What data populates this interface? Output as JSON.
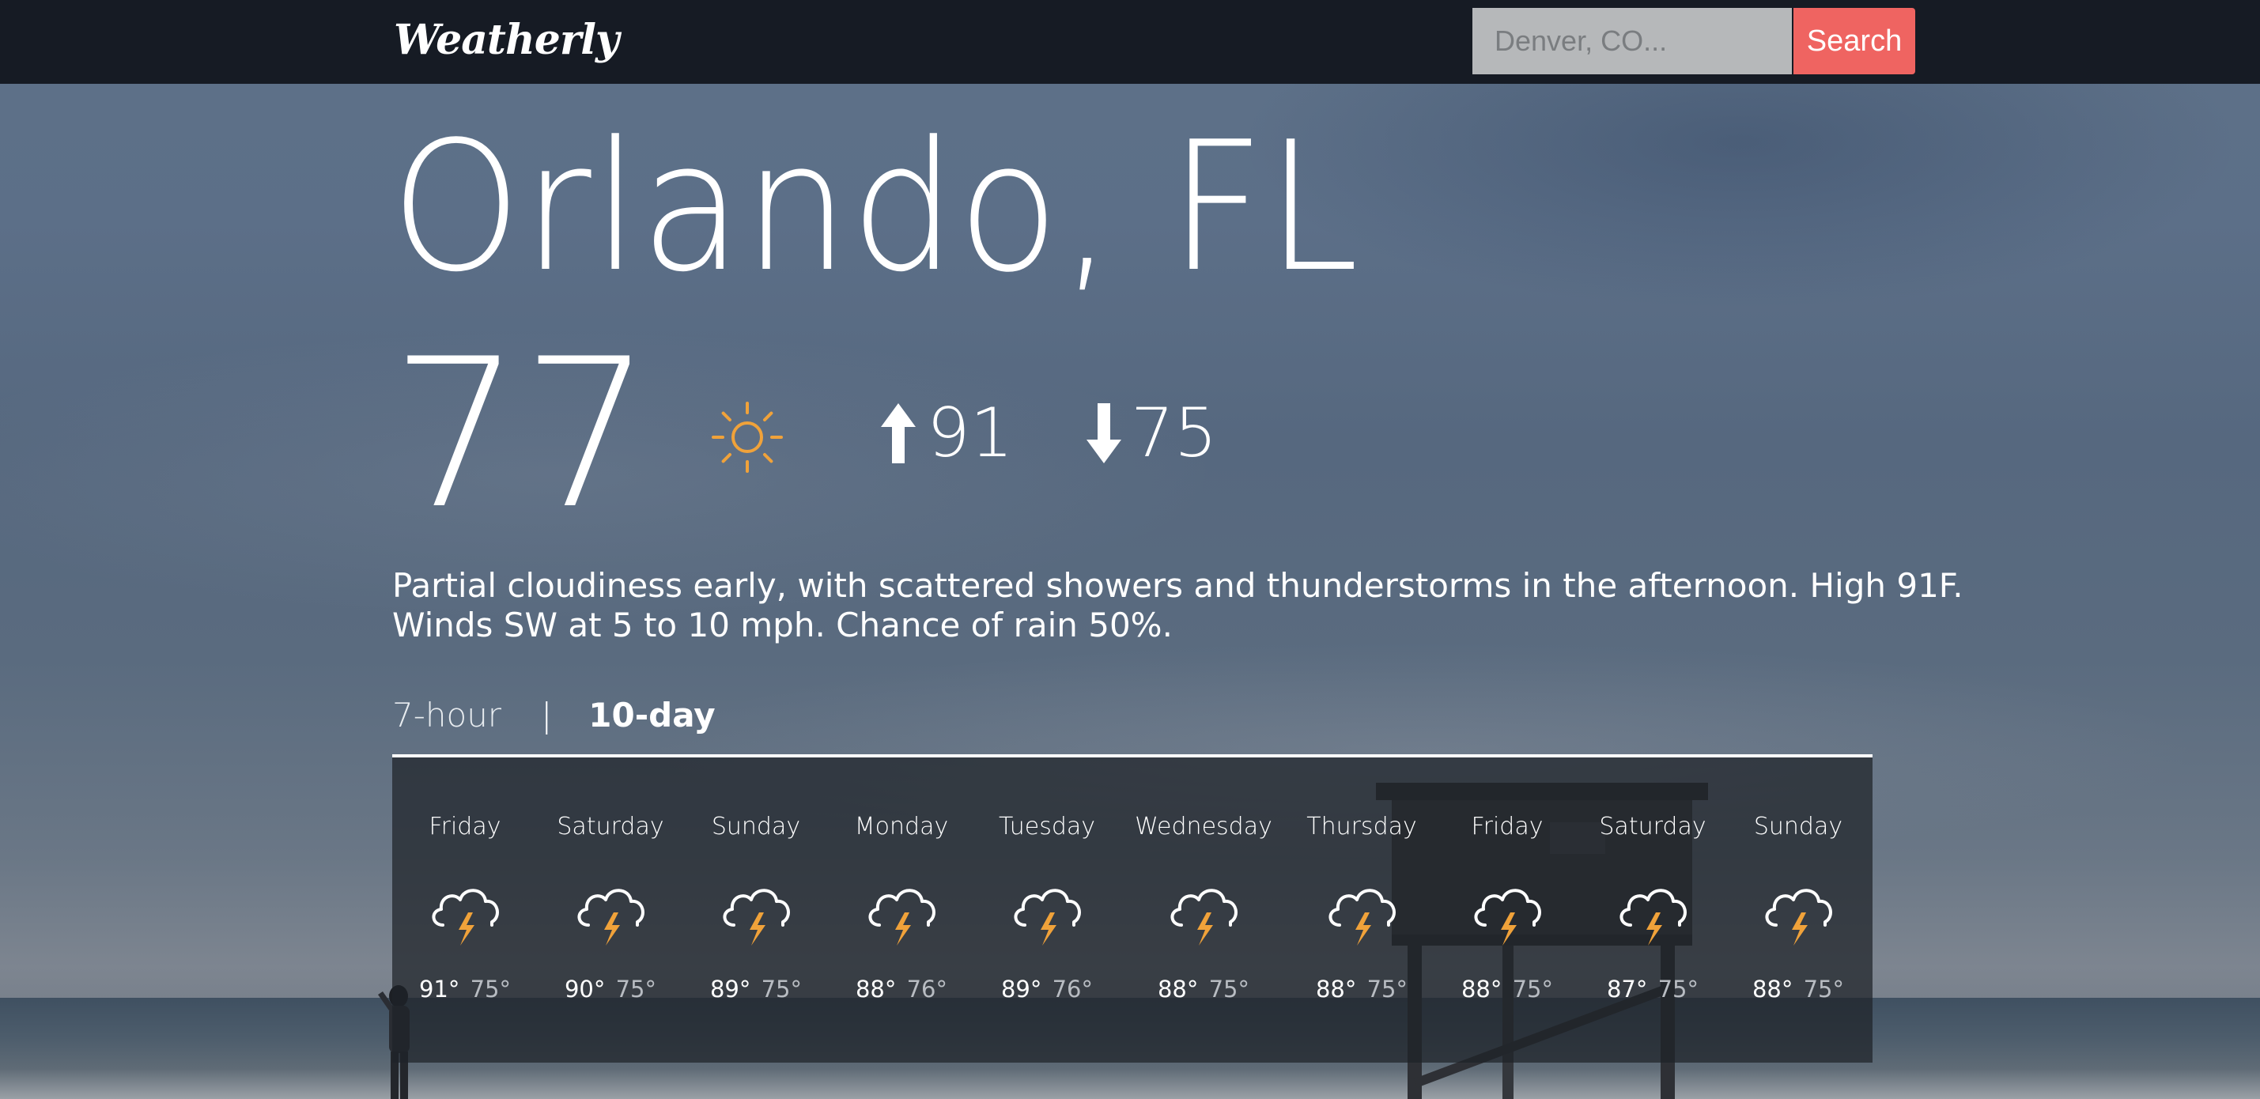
{
  "app": {
    "logo": "Weatherly"
  },
  "search": {
    "placeholder": "Denver, CO...",
    "button_label": "Search"
  },
  "current": {
    "city": "Orlando, FL",
    "temp": "77",
    "condition_icon": "sun-icon",
    "high": "91",
    "low": "75",
    "summary": "Partial cloudiness early, with scattered showers and thunderstorms in the afternoon. High 91F. Winds SW at 5 to 10 mph. Chance of rain 50%."
  },
  "tabs": {
    "hourly": "7-hour",
    "separator": "|",
    "daily": "10-day",
    "active": "10-day"
  },
  "forecast": [
    {
      "day": "Friday",
      "icon": "thunderstorm-icon",
      "high": "91°",
      "low": "75°"
    },
    {
      "day": "Saturday",
      "icon": "thunderstorm-icon",
      "high": "90°",
      "low": "75°"
    },
    {
      "day": "Sunday",
      "icon": "thunderstorm-icon",
      "high": "89°",
      "low": "75°"
    },
    {
      "day": "Monday",
      "icon": "thunderstorm-icon",
      "high": "88°",
      "low": "76°"
    },
    {
      "day": "Tuesday",
      "icon": "thunderstorm-icon",
      "high": "89°",
      "low": "76°"
    },
    {
      "day": "Wednesday",
      "icon": "thunderstorm-icon",
      "high": "88°",
      "low": "75°"
    },
    {
      "day": "Thursday",
      "icon": "thunderstorm-icon",
      "high": "88°",
      "low": "75°"
    },
    {
      "day": "Friday",
      "icon": "thunderstorm-icon",
      "high": "88°",
      "low": "75°"
    },
    {
      "day": "Saturday",
      "icon": "thunderstorm-icon",
      "high": "87°",
      "low": "75°"
    },
    {
      "day": "Sunday",
      "icon": "thunderstorm-icon",
      "high": "88°",
      "low": "75°"
    }
  ],
  "colors": {
    "navbar": "#161b24",
    "search_button": "#ef6461",
    "sun": "#f0a23a",
    "lightning": "#f0a23a"
  }
}
